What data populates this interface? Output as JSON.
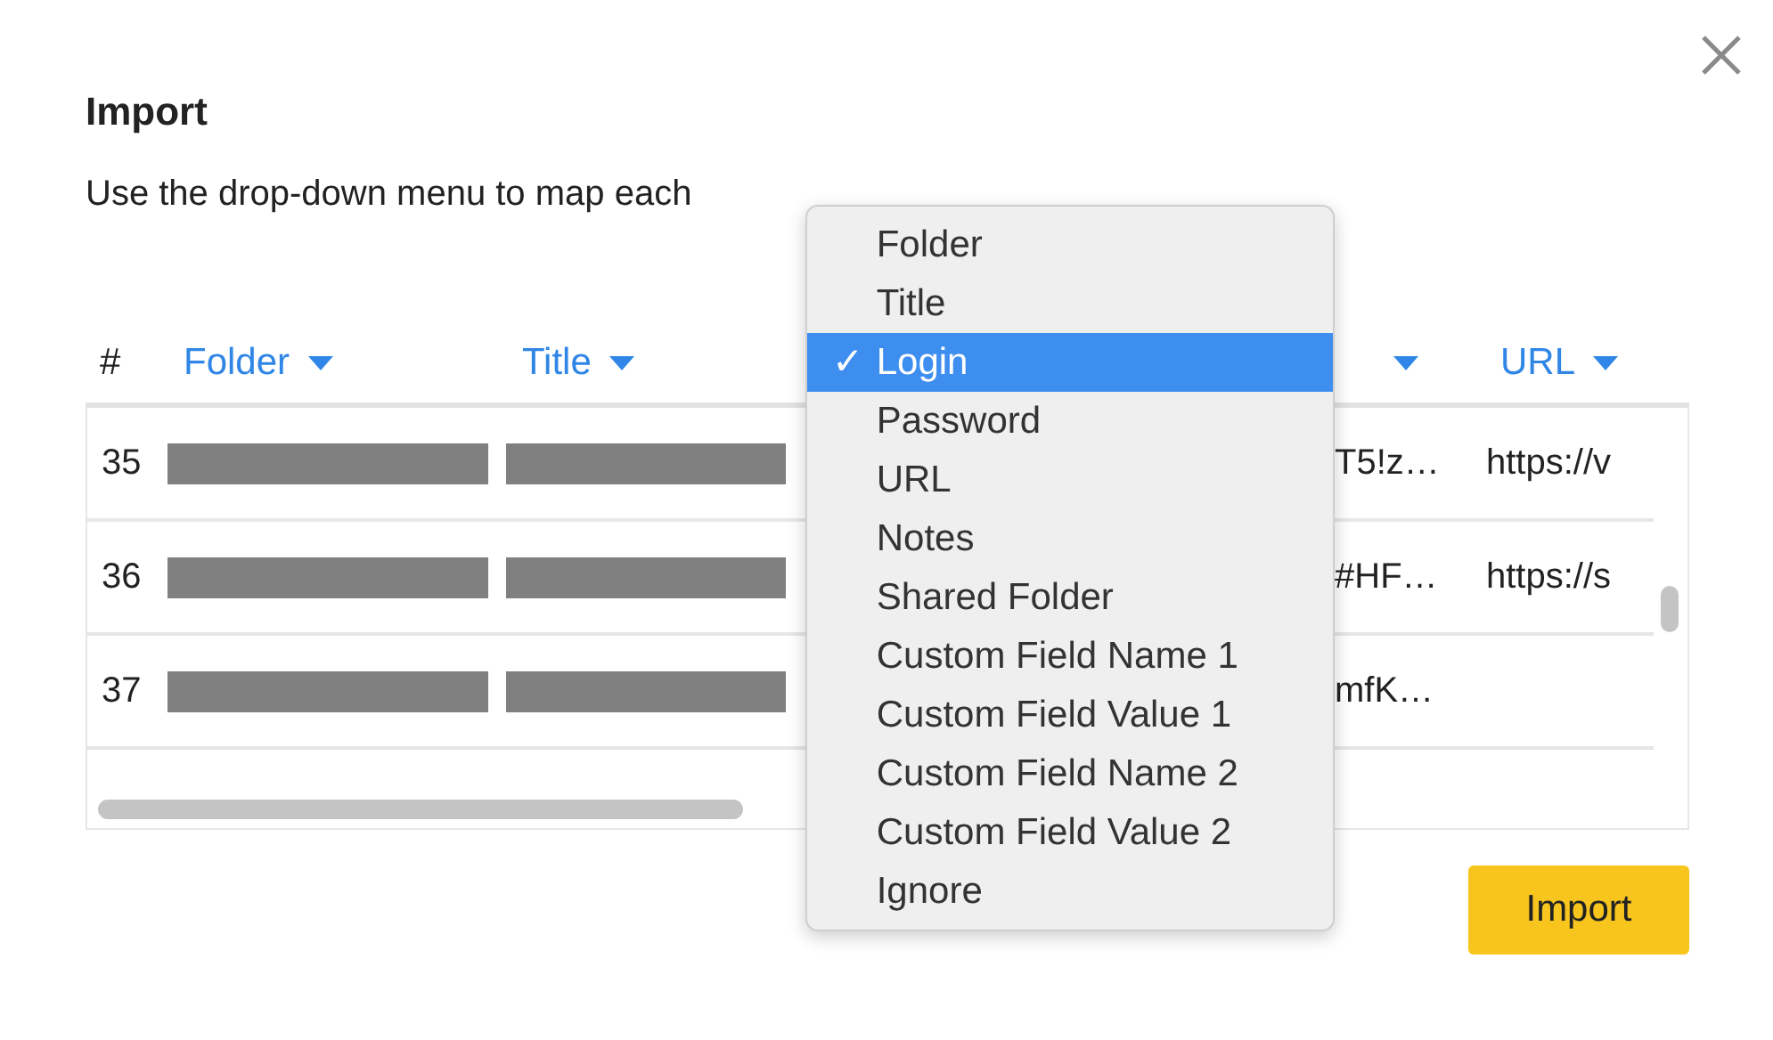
{
  "dialog": {
    "title": "Import",
    "description": "Use the drop-down menu to map each"
  },
  "table": {
    "number_header": "#",
    "columns": [
      {
        "label": "Folder",
        "dropdown": true
      },
      {
        "label": "Title",
        "dropdown": true
      },
      {
        "dropdown": true
      },
      {
        "label": "URL",
        "dropdown": true
      }
    ],
    "rows": [
      {
        "number": "35",
        "cells": [
          {
            "kind": "redacted"
          },
          {
            "kind": "redacted"
          },
          {
            "kind": "text",
            "text": "T5!z…"
          },
          {
            "kind": "text",
            "text": "https://v"
          }
        ]
      },
      {
        "number": "36",
        "cells": [
          {
            "kind": "redacted"
          },
          {
            "kind": "redacted"
          },
          {
            "kind": "text",
            "text": "#HF…"
          },
          {
            "kind": "text",
            "text": "https://s"
          }
        ]
      },
      {
        "number": "37",
        "cells": [
          {
            "kind": "redacted"
          },
          {
            "kind": "redacted"
          },
          {
            "kind": "text",
            "text": "mfK…"
          },
          null
        ]
      }
    ]
  },
  "menu": {
    "items": [
      {
        "label": "Folder",
        "selected": false
      },
      {
        "label": "Title",
        "selected": false
      },
      {
        "label": "Login",
        "selected": true
      },
      {
        "label": "Password",
        "selected": false
      },
      {
        "label": "URL",
        "selected": false
      },
      {
        "label": "Notes",
        "selected": false
      },
      {
        "label": "Shared Folder",
        "selected": false
      },
      {
        "label": "Custom Field Name 1",
        "selected": false
      },
      {
        "label": "Custom Field Value 1",
        "selected": false
      },
      {
        "label": "Custom Field Name 2",
        "selected": false
      },
      {
        "label": "Custom Field Value 2",
        "selected": false
      },
      {
        "label": "Ignore",
        "selected": false
      }
    ]
  },
  "buttons": [
    {
      "label": "Import"
    }
  ],
  "check_mark": "✓"
}
